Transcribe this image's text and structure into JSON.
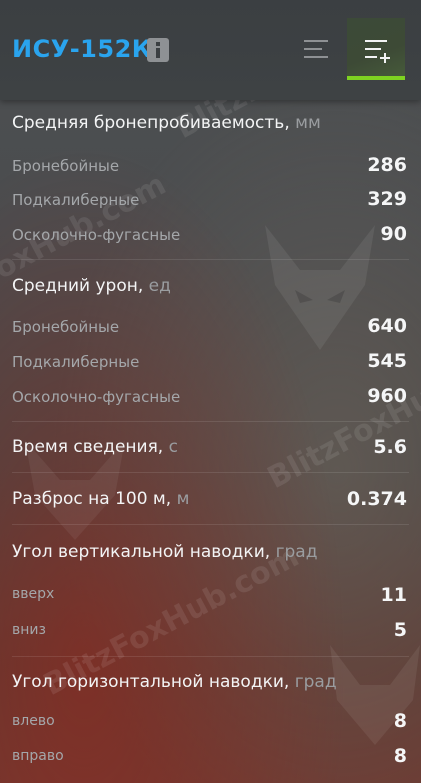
{
  "header": {
    "title": "ИСУ-152К",
    "info_icon": "info-icon",
    "list_icon": "list-icon",
    "compare_icon": "add-to-compare-icon",
    "accent_color": "#2aa4ee",
    "active_color": "#7ed321"
  },
  "watermark": "BlitzFoxHub.com",
  "penetration": {
    "title": "Средняя бронепробиваемость,",
    "unit": "мм",
    "rows": [
      {
        "label": "Бронебойные",
        "value": "286"
      },
      {
        "label": "Подкалиберные",
        "value": "329"
      },
      {
        "label": "Осколочно-фугасные",
        "value": "90"
      }
    ]
  },
  "damage": {
    "title": "Средний урон,",
    "unit": "ед",
    "rows": [
      {
        "label": "Бронебойные",
        "value": "640"
      },
      {
        "label": "Подкалиберные",
        "value": "545"
      },
      {
        "label": "Осколочно-фугасные",
        "value": "960"
      }
    ]
  },
  "aim_time": {
    "title": "Время сведения,",
    "unit": "с",
    "value": "5.6"
  },
  "dispersion": {
    "title": "Разброс на 100 м,",
    "unit": "м",
    "value": "0.374"
  },
  "vertical": {
    "title": "Угол вертикальной наводки,",
    "unit": "град",
    "rows": [
      {
        "label": "вверх",
        "value": "11"
      },
      {
        "label": "вниз",
        "value": "5"
      }
    ]
  },
  "horizontal": {
    "title": "Угол горизонтальной наводки,",
    "unit": "град",
    "rows": [
      {
        "label": "влево",
        "value": "8"
      },
      {
        "label": "вправо",
        "value": "8"
      }
    ]
  }
}
